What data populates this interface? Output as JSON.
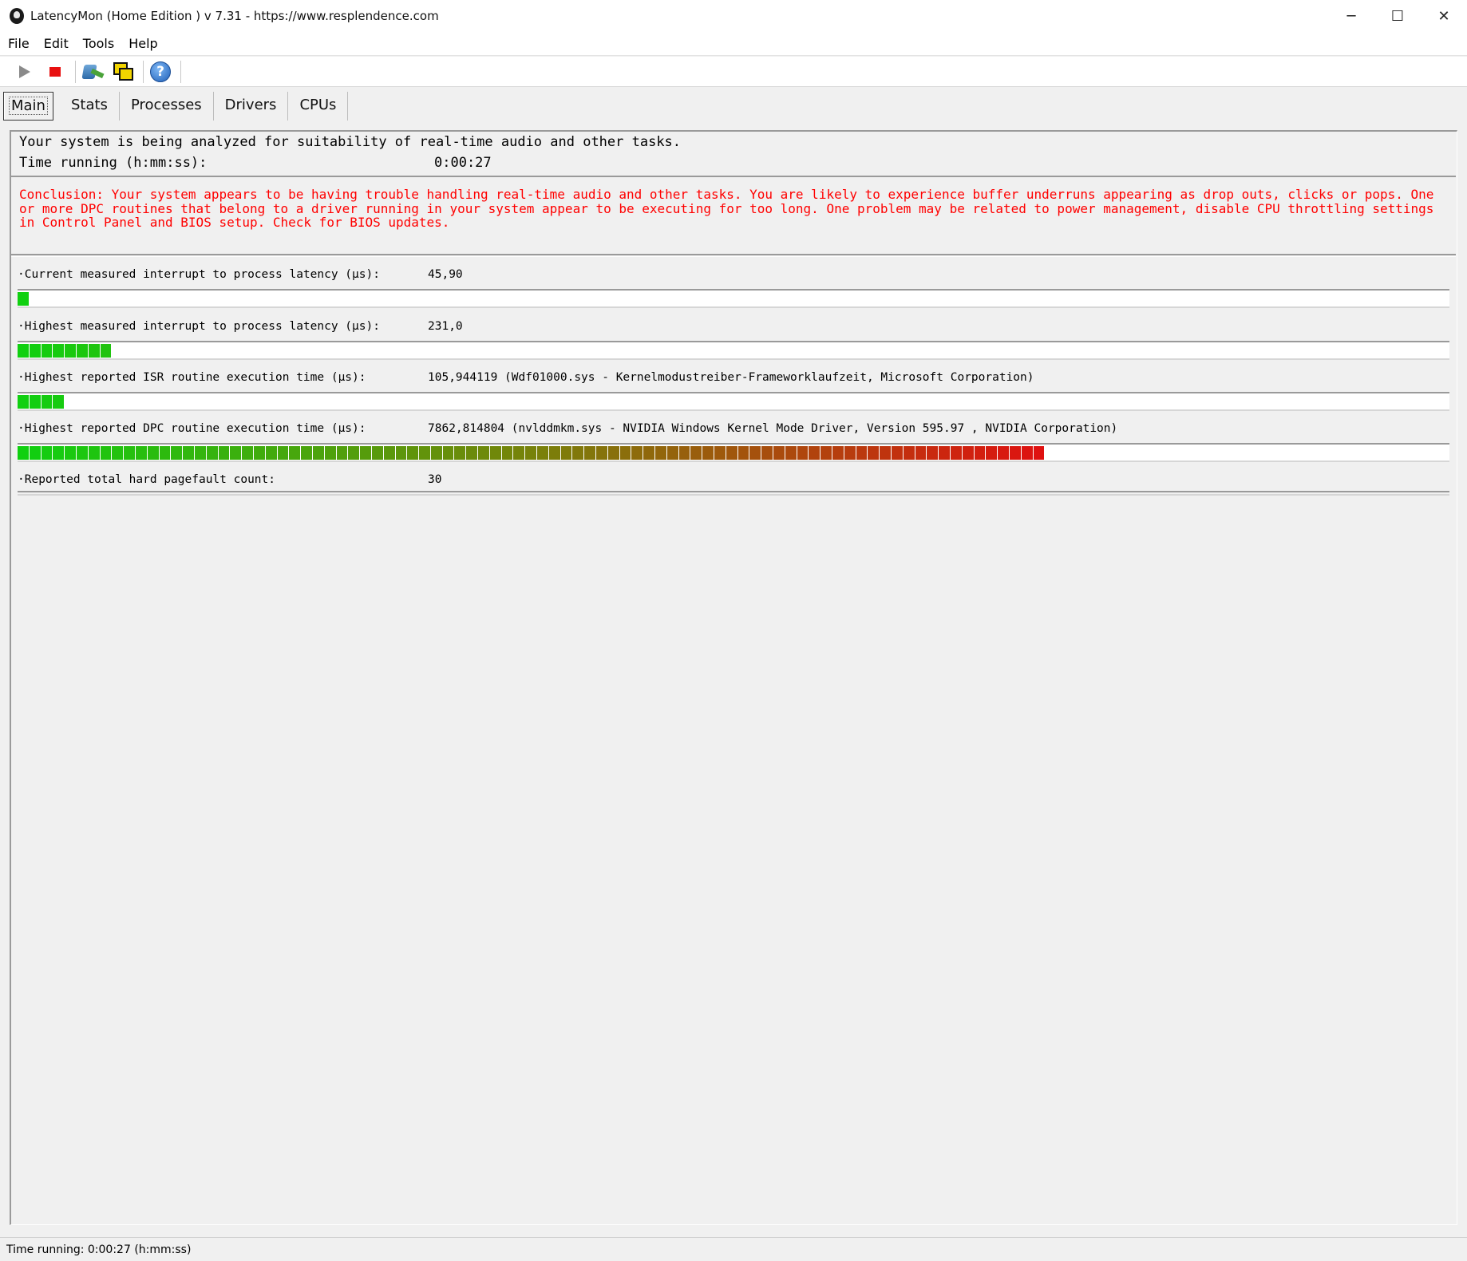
{
  "window": {
    "title": "LatencyMon  (Home Edition )  v 7.31 - https://www.resplendence.com",
    "minimize": "─",
    "maximize": "☐",
    "close": "✕"
  },
  "menu": {
    "items": [
      {
        "label": "File"
      },
      {
        "label": "Edit"
      },
      {
        "label": "Tools"
      },
      {
        "label": "Help"
      }
    ]
  },
  "toolbar": {
    "icons": [
      "play-icon",
      "stop-icon",
      "drivers-icon",
      "windows-icon",
      "help-icon"
    ],
    "help_label": "?"
  },
  "tabs": [
    {
      "label": "Main",
      "active": true
    },
    {
      "label": "Stats"
    },
    {
      "label": "Processes"
    },
    {
      "label": "Drivers"
    },
    {
      "label": "CPUs"
    }
  ],
  "main": {
    "analysis_text": "Your system is being analyzed for suitability of real-time audio and other tasks.",
    "time_running_label": "Time running (h:mm:ss):",
    "time_running_value": "0:00:27",
    "conclusion": "Conclusion: Your system appears to be having trouble handling real-time audio and other tasks. You are likely to experience buffer underruns appearing as drop outs, clicks or pops. One or more DPC routines that belong to a driver running in your system appear to be executing for too long. One problem may be related to power management, disable CPU throttling settings in Control Panel and BIOS setup. Check for BIOS updates.",
    "conclusion_color": "#ff0000",
    "metrics": [
      {
        "label": "·Current measured interrupt to process latency (µs):",
        "value": "45,90",
        "bar_segments": 1
      },
      {
        "label": "·Highest measured interrupt to process latency (µs):",
        "value": "231,0",
        "bar_segments": 8
      },
      {
        "label": "·Highest reported ISR routine execution time (µs):",
        "value": "105,944119  (Wdf01000.sys - Kernelmodustreiber-Frameworklaufzeit, Microsoft Corporation)",
        "bar_segments": 4
      },
      {
        "label": "·Highest reported DPC routine execution time (µs):",
        "value": "7862,814804  (nvlddmkm.sys - NVIDIA Windows Kernel Mode Driver, Version 595.97 , NVIDIA Corporation)",
        "bar_segments": 87
      },
      {
        "label": "·Reported total hard pagefault count:",
        "value": "30",
        "bar_segments": 0
      }
    ],
    "bar_colors": {
      "start": "#10d010",
      "end": "#e01010"
    }
  },
  "status": {
    "text": "Time running: 0:00:27  (h:mm:ss)"
  }
}
